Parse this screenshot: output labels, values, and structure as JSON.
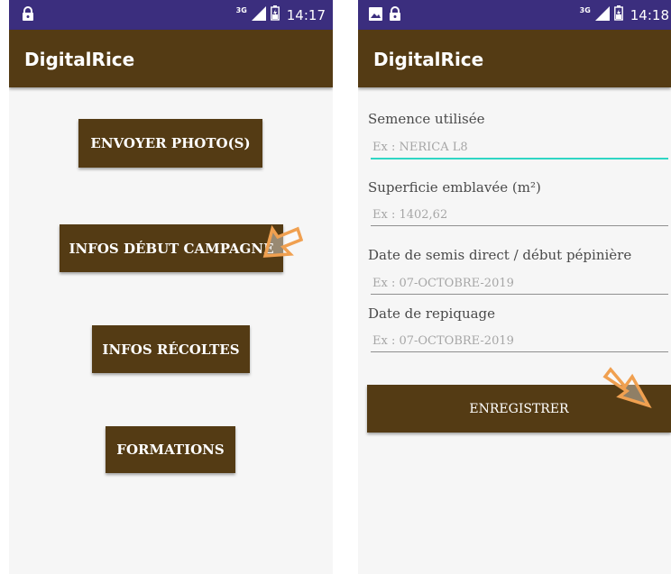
{
  "colors": {
    "status_bar": "#3b2e7e",
    "app_bar": "#543b14",
    "button": "#543b14",
    "focus_underline": "#2fd6c4",
    "arrow": "#f0a050"
  },
  "left_screen": {
    "status_bar": {
      "network": "3G",
      "time": "14:17",
      "icons": [
        "lock-icon",
        "signal-icon",
        "battery-icon"
      ]
    },
    "app_title": "DigitalRice",
    "buttons": {
      "photos": "ENVOYER  PHOTO(S)",
      "debut": "INFOS DÉBUT CAMPAGNE",
      "recoltes": "INFOS RÉCOLTES",
      "formations": "FORMATIONS"
    }
  },
  "right_screen": {
    "status_bar": {
      "network": "3G",
      "time": "14:18",
      "icons": [
        "image-icon",
        "lock-icon",
        "signal-icon",
        "battery-icon"
      ]
    },
    "app_title": "DigitalRice",
    "fields": {
      "semence": {
        "label": "Semence utilisée",
        "placeholder": "Ex : NERICA L8",
        "value": ""
      },
      "superficie": {
        "label": "Superficie emblavée (m²)",
        "placeholder": "Ex : 1402,62",
        "value": ""
      },
      "semis": {
        "label": "Date de semis direct / début pépinière",
        "placeholder": "Ex : 07-OCTOBRE-2019",
        "value": ""
      },
      "repiquage": {
        "label": "Date de repiquage",
        "placeholder": "Ex : 07-OCTOBRE-2019",
        "value": ""
      }
    },
    "save_label": "ENREGISTRER"
  }
}
